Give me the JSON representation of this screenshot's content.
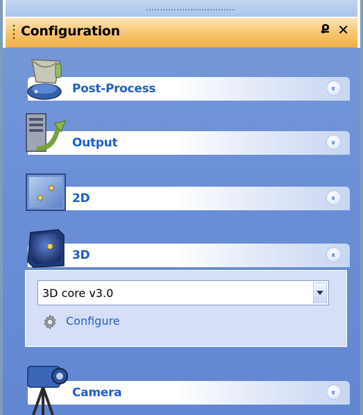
{
  "panel": {
    "title": "Configuration",
    "pin_glyph": "Ք",
    "close_glyph": "✕"
  },
  "sections": [
    {
      "label": "Post-Process",
      "icon": "post-process-icon",
      "state": "collapsed",
      "chevron": "»"
    },
    {
      "label": "Output",
      "icon": "output-icon",
      "state": "collapsed",
      "chevron": "»"
    },
    {
      "label": "2D",
      "icon": "2d-icon",
      "state": "collapsed",
      "chevron": "»"
    },
    {
      "label": "3D",
      "icon": "3d-icon",
      "state": "expanded",
      "chevron": "«"
    },
    {
      "label": "Camera",
      "icon": "camera-icon",
      "state": "collapsed",
      "chevron": "»"
    }
  ],
  "section_3d": {
    "selected": "3D core v3.0",
    "configure_label": "Configure",
    "configure_icon": "gear-icon"
  },
  "colors": {
    "title_bar": "#f7c46a",
    "pane_bg": "#6b8fd6",
    "header_text": "#215dc6",
    "expanded_body": "#d6dff7"
  }
}
